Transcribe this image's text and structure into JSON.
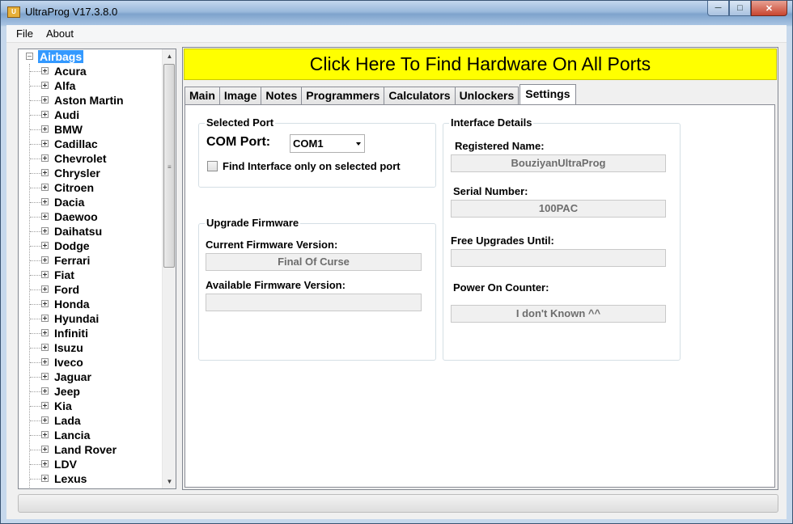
{
  "window": {
    "title": "UltraProg V17.3.8.0",
    "icon_text": "U"
  },
  "menu": [
    "File",
    "About"
  ],
  "tree": {
    "root": "Airbags",
    "items": [
      "Acura",
      "Alfa",
      "Aston Martin",
      "Audi",
      "BMW",
      "Cadillac",
      "Chevrolet",
      "Chrysler",
      "Citroen",
      "Dacia",
      "Daewoo",
      "Daihatsu",
      "Dodge",
      "Ferrari",
      "Fiat",
      "Ford",
      "Honda",
      "Hyundai",
      "Infiniti",
      "Isuzu",
      "Iveco",
      "Jaguar",
      "Jeep",
      "Kia",
      "Lada",
      "Lancia",
      "Land Rover",
      "LDV",
      "Lexus"
    ]
  },
  "banner": "Click Here To Find Hardware On All Ports",
  "tabs": [
    "Main",
    "Image",
    "Notes",
    "Programmers",
    "Calculators",
    "Unlockers",
    "Settings"
  ],
  "selected_port": {
    "title": "Selected Port",
    "com_label": "COM Port:",
    "com_value": "COM1",
    "checkbox_label": "Find Interface only on selected port",
    "checkbox_checked": false
  },
  "upgrade": {
    "title": "Upgrade Firmware",
    "current_label": "Current Firmware Version:",
    "current_value": "Final Of Curse",
    "available_label": "Available Firmware Version:",
    "available_value": ""
  },
  "interface": {
    "title": "Interface Details",
    "registered_label": "Registered Name:",
    "registered_value": "BouziyanUltraProg",
    "serial_label": "Serial Number:",
    "serial_value": "100PAC",
    "upgrades_label": "Free Upgrades Until:",
    "upgrades_value": "",
    "counter_label": "Power On Counter:",
    "counter_value": "I don't Known ^^"
  },
  "colors": {
    "banner_bg": "#ffff00",
    "selection": "#3399ff"
  }
}
